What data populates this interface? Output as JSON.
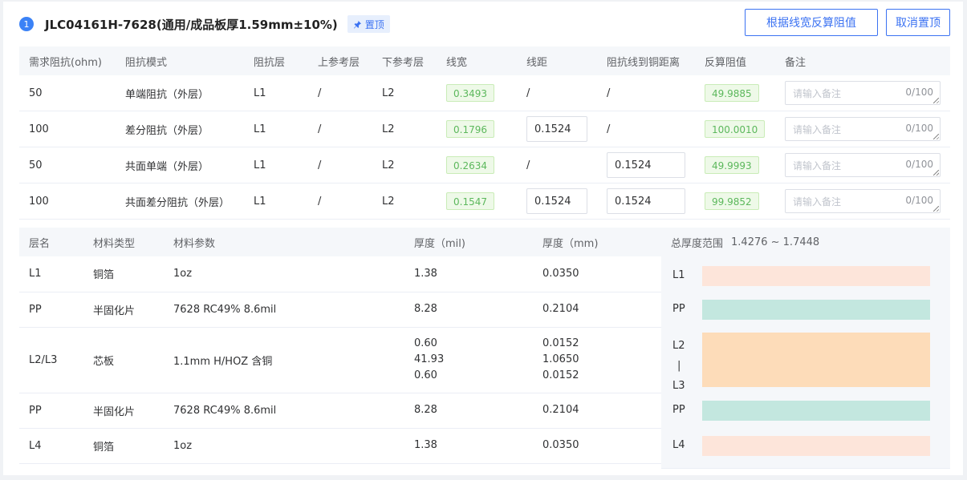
{
  "header": {
    "index": "1",
    "title": "JLC04161H-7628(通用/成品板厚1.59mm±10%)",
    "pin_tag": "置顶",
    "calc_button": "根据线宽反算阻值",
    "unpin_button": "取消置顶"
  },
  "impedance": {
    "columns": [
      "需求阻抗(ohm)",
      "阻抗模式",
      "阻抗层",
      "上参考层",
      "下参考层",
      "线宽",
      "线距",
      "阻抗线到铜距离",
      "反算阻值",
      "备注"
    ],
    "remark_placeholder": "请输入备注",
    "remark_count": "0/100",
    "rows": [
      {
        "impedance": "50",
        "mode": "单端阻抗（外层）",
        "layer": "L1",
        "upper_ref": "/",
        "lower_ref": "L2",
        "width": "0.3493",
        "spacing": "/",
        "copper_dist": "/",
        "calc": "49.9885"
      },
      {
        "impedance": "100",
        "mode": "差分阻抗（外层）",
        "layer": "L1",
        "upper_ref": "/",
        "lower_ref": "L2",
        "width": "0.1796",
        "spacing": "0.1524",
        "copper_dist": "/",
        "calc": "100.0010"
      },
      {
        "impedance": "50",
        "mode": "共面单端（外层）",
        "layer": "L1",
        "upper_ref": "/",
        "lower_ref": "L2",
        "width": "0.2634",
        "spacing": "/",
        "copper_dist": "0.1524",
        "calc": "49.9993"
      },
      {
        "impedance": "100",
        "mode": "共面差分阻抗（外层）",
        "layer": "L1",
        "upper_ref": "/",
        "lower_ref": "L2",
        "width": "0.1547",
        "spacing": "0.1524",
        "copper_dist": "0.1524",
        "calc": "99.9852"
      }
    ]
  },
  "stackup": {
    "columns": [
      "层名",
      "材料类型",
      "材料参数",
      "厚度（mil)",
      "厚度（mm)"
    ],
    "rows": [
      {
        "layer": "L1",
        "type": "铜箔",
        "param": "1oz",
        "mil": [
          "1.38"
        ],
        "mm": [
          "0.0350"
        ]
      },
      {
        "layer": "PP",
        "type": "半固化片",
        "param": "7628 RC49% 8.6mil",
        "mil": [
          "8.28"
        ],
        "mm": [
          "0.2104"
        ]
      },
      {
        "layer": "L2/L3",
        "type": "芯板",
        "param": "1.1mm H/HOZ 含铜",
        "mil": [
          "0.60",
          "41.93",
          "0.60"
        ],
        "mm": [
          "0.0152",
          "1.0650",
          "0.0152"
        ]
      },
      {
        "layer": "PP",
        "type": "半固化片",
        "param": "7628 RC49% 8.6mil",
        "mil": [
          "8.28"
        ],
        "mm": [
          "0.2104"
        ]
      },
      {
        "layer": "L4",
        "type": "铜箔",
        "param": "1oz",
        "mil": [
          "1.38"
        ],
        "mm": [
          "0.0350"
        ]
      }
    ]
  },
  "diagram": {
    "title": "总厚度范围",
    "range": "1.4276 ~ 1.7448",
    "layers": [
      {
        "label": "L1",
        "kind": "copper"
      },
      {
        "label": "PP",
        "kind": "prepreg"
      },
      {
        "label": "L2\n|\nL3",
        "kind": "core"
      },
      {
        "label": "PP",
        "kind": "prepreg"
      },
      {
        "label": "L4",
        "kind": "copper"
      }
    ],
    "colors": {
      "copper": "#fde5da",
      "prepreg": "#c3e7df",
      "core": "#fddcb9"
    }
  }
}
